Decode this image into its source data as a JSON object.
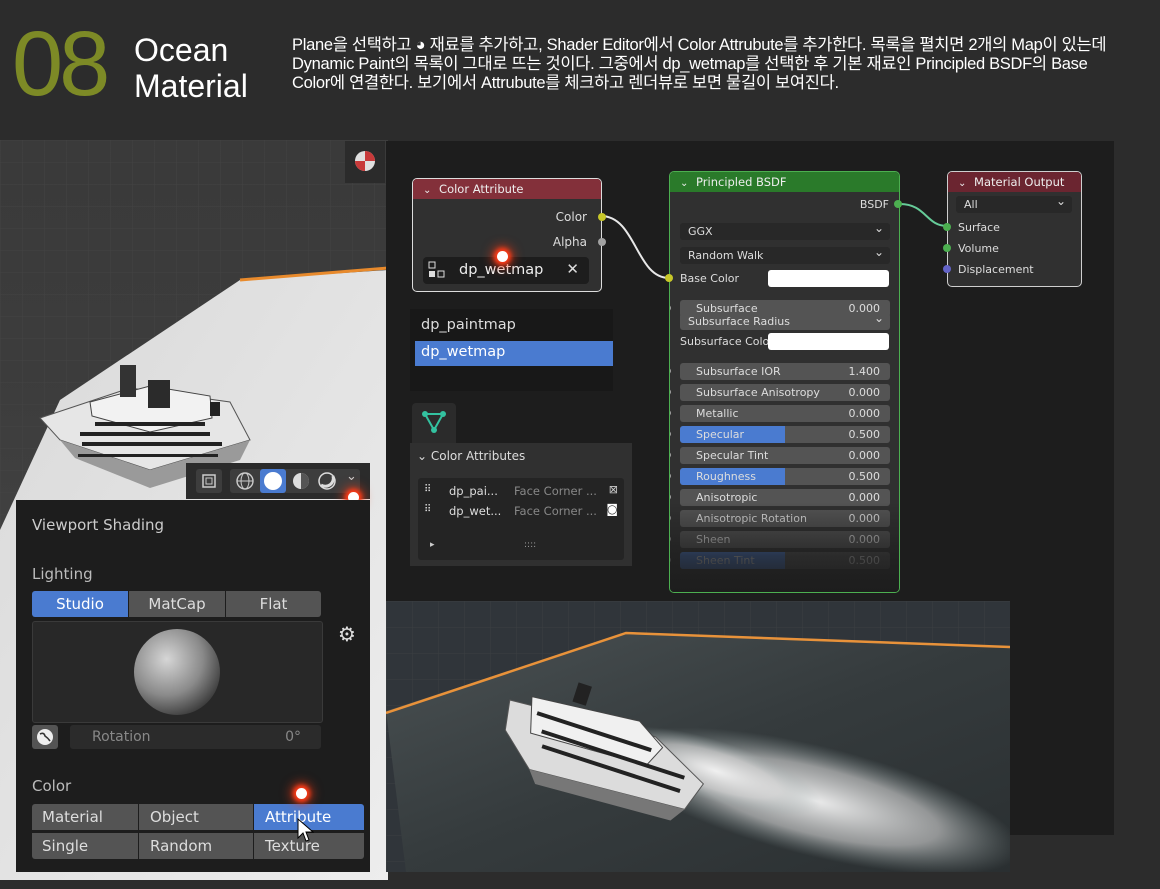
{
  "header": {
    "number": "08",
    "title_line1": "Ocean",
    "title_line2": "Material",
    "description": "Plane을  선택하고 ◕ 재료를 추가하고, Shader Editor에서 Color Attrubute를 추가한다. 목록을 펼치면 2개의 Map이 있는데 Dynamic Paint의 목록이 그대로 뜨는 것이다. 그중에서 dp_wetmap를 선택한 후  기본 재료인 Principled BSDF의 Base Color에 연결한다.  보기에서 Attrubute를 체크하고 렌더뷰로 보면 물길이 보여진다."
  },
  "color_attribute_node": {
    "title": "Color Attribute",
    "out_color": "Color",
    "out_alpha": "Alpha",
    "selected_attr": "dp_wetmap",
    "clear": "✕"
  },
  "attr_dropdown": {
    "items": [
      "dp_paintmap",
      "dp_wetmap"
    ],
    "selected": "dp_wetmap"
  },
  "color_attributes_panel": {
    "title": "Color Attributes",
    "rows": [
      {
        "name": "dp_pai...",
        "domain": "Face Corner ..."
      },
      {
        "name": "dp_wet...",
        "domain": "Face Corner ..."
      }
    ],
    "play": "▸",
    "grip": "::::"
  },
  "principled_node": {
    "title": "Principled BSDF",
    "out": "BSDF",
    "distribution": "GGX",
    "subsurface_method": "Random Walk",
    "base_color": "Base Color",
    "subsurface_radius": "Subsurface Radius",
    "subsurface_color": "Subsurface Colo",
    "fields": [
      {
        "label": "Subsurface",
        "value": "0.000",
        "fill": 0
      },
      {
        "label": "Subsurface IOR",
        "value": "1.400",
        "fill": 0.0
      },
      {
        "label": "Subsurface Anisotropy",
        "value": "0.000",
        "fill": 0
      },
      {
        "label": "Metallic",
        "value": "0.000",
        "fill": 0
      },
      {
        "label": "Specular",
        "value": "0.500",
        "fill": 0.5
      },
      {
        "label": "Specular Tint",
        "value": "0.000",
        "fill": 0
      },
      {
        "label": "Roughness",
        "value": "0.500",
        "fill": 0.5
      },
      {
        "label": "Anisotropic",
        "value": "0.000",
        "fill": 0
      },
      {
        "label": "Anisotropic Rotation",
        "value": "0.000",
        "fill": 0
      },
      {
        "label": "Sheen",
        "value": "0.000",
        "fill": 0
      },
      {
        "label": "Sheen Tint",
        "value": "0.500",
        "fill": 0.5
      }
    ]
  },
  "material_output_node": {
    "title": "Material Output",
    "target": "All",
    "in_surface": "Surface",
    "in_volume": "Volume",
    "in_displacement": "Displacement"
  },
  "viewport_shading": {
    "title": "Viewport Shading",
    "lighting_label": "Lighting",
    "lighting_modes": [
      "Studio",
      "MatCap",
      "Flat"
    ],
    "lighting_active": "Studio",
    "rotation_label": "Rotation",
    "rotation_value": "0°",
    "color_label": "Color",
    "color_modes": [
      "Material",
      "Object",
      "Attribute",
      "Single",
      "Random",
      "Texture"
    ],
    "color_active": "Attribute"
  },
  "colors": {
    "accent_olive": "#7d8a26",
    "color_attr_header": "#83303a",
    "principled_header": "#2a7a2a",
    "output_header": "#6b2530",
    "blender_blue": "#4a7bd0",
    "socket_yellow": "#c7c729",
    "socket_green": "#4caf50",
    "socket_purple": "#6363c7",
    "socket_grey": "#a1a1a1",
    "marker_red": "#ff3b18"
  }
}
